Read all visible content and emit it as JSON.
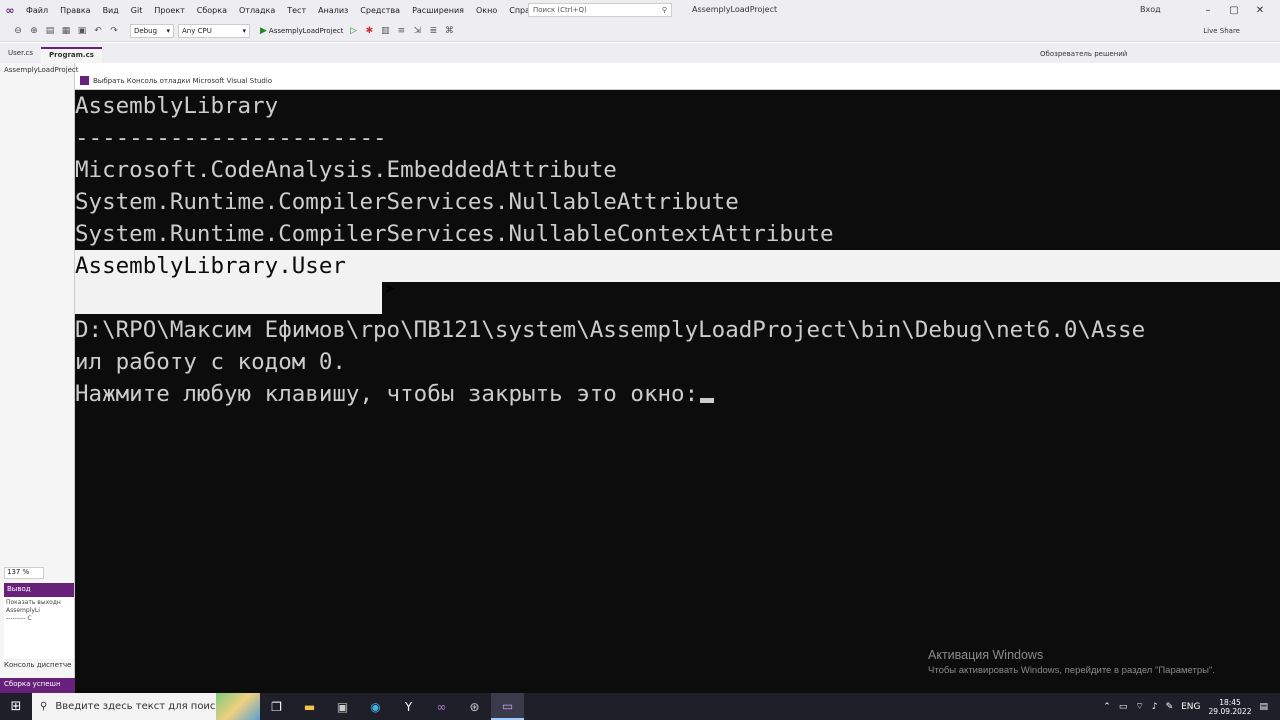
{
  "vs": {
    "menu": [
      "Файл",
      "Правка",
      "Вид",
      "Git",
      "Проект",
      "Сборка",
      "Отладка",
      "Тест",
      "Анализ",
      "Средства",
      "Расширения",
      "Окно",
      "Справка"
    ],
    "search_placeholder": "Поиск (Ctrl+Q)",
    "window_title": "AssemplyLoadProject",
    "sign_in": "Вход",
    "toolbar": {
      "config": "Debug",
      "platform": "Any CPU",
      "run_label": "AssemplyLoadProject",
      "live_share": "Live Share"
    },
    "tabs": [
      "User.cs",
      "Program.cs"
    ],
    "solution_explorer": "Обозреватель решений",
    "left_project": "AssemplyLoadProject",
    "zoom": "137 %",
    "output_title": "Вывод",
    "output_lines": [
      "Показать выходн",
      "",
      "AssemplyLi",
      "--------- C"
    ],
    "console_tab": "Консоль диспетче",
    "status": "Сборка успешн"
  },
  "console": {
    "title": "Выбрать Консоль отладки Microsoft Visual Studio",
    "lines": [
      "AssemblyLibrary",
      "-----------------------",
      "Microsoft.CodeAnalysis.EmbeddedAttribute",
      "System.Runtime.CompilerServices.NullableAttribute",
      "System.Runtime.CompilerServices.NullableContextAttribute",
      "AssemblyLibrary.User",
      "",
      "D:\\RPO\\Максим Ефимов\\rpo\\ПВ121\\system\\AssemplyLoadProject\\bin\\Debug\\net6.0\\Asse",
      "ил работу с кодом 0.",
      "Нажмите любую клавишу, чтобы закрыть это окно:"
    ]
  },
  "watermark": {
    "title": "Активация Windows",
    "subtitle": "Чтобы активировать Windows, перейдите в раздел \"Параметры\"."
  },
  "taskbar": {
    "search_placeholder": "Введите здесь текст для поиска",
    "language": "ENG",
    "time": "18:45",
    "date": "29.09.2022"
  }
}
